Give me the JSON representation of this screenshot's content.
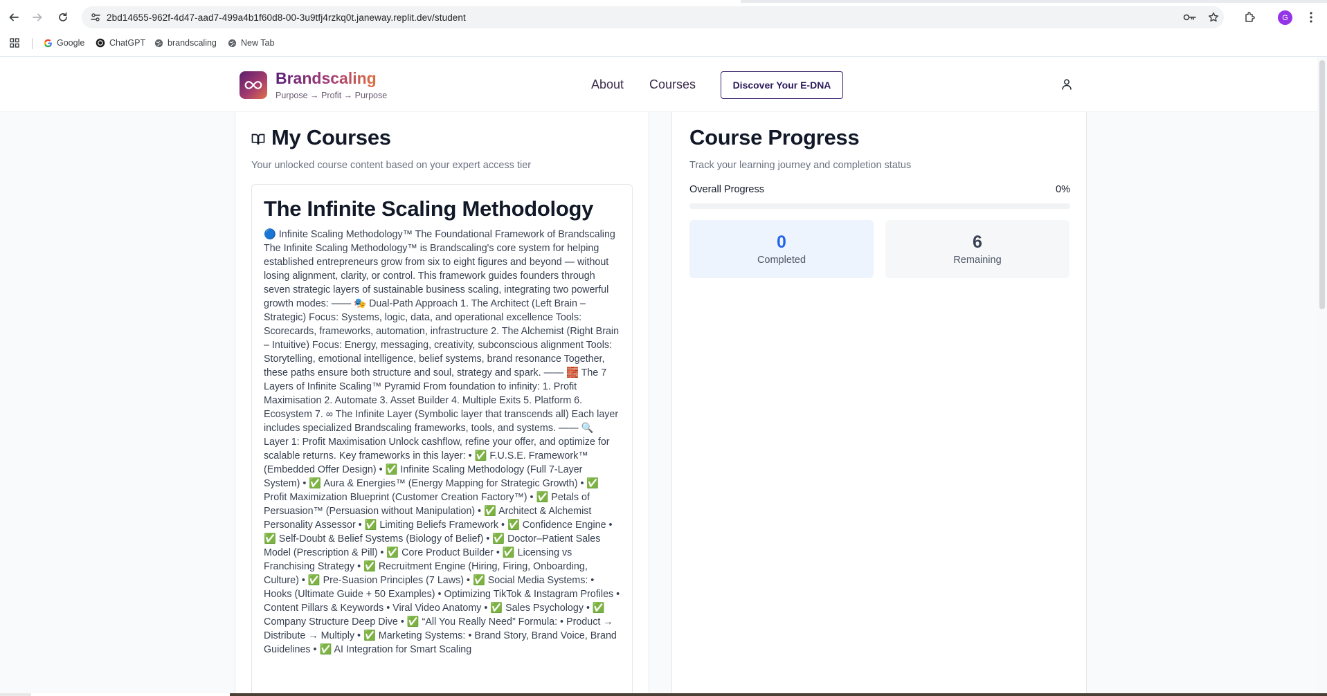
{
  "browser": {
    "url": "2bd14655-962f-4d47-aad7-499a4b1f60d8-00-3u9tfj4rzkq0t.janeway.replit.dev/student",
    "profile_initial": "G",
    "bookmarks": [
      {
        "label": "Google",
        "icon": "google-icon"
      },
      {
        "label": "ChatGPT",
        "icon": "chatgpt-icon"
      },
      {
        "label": "brandscaling",
        "icon": "globe-icon"
      },
      {
        "label": "New Tab",
        "icon": "globe-icon"
      }
    ]
  },
  "header": {
    "brand_name": "Brandscaling",
    "tagline": "Purpose → Profit → Purpose",
    "nav": {
      "about": "About",
      "courses": "Courses"
    },
    "cta_label": "Discover Your E-DNA"
  },
  "my_courses": {
    "title": "My Courses",
    "subtitle": "Your unlocked course content based on your expert access tier",
    "course": {
      "title": "The Infinite Scaling Methodology",
      "description": "🔵 Infinite Scaling Methodology™ The Foundational Framework of Brandscaling The Infinite Scaling Methodology™ is Brandscaling's core system for helping established entrepreneurs grow from six to eight figures and beyond — without losing alignment, clarity, or control. This framework guides founders through seven strategic layers of sustainable business scaling, integrating two powerful growth modes: —— 🎭 Dual-Path Approach 1. The Architect (Left Brain – Strategic) Focus: Systems, logic, data, and operational excellence Tools: Scorecards, frameworks, automation, infrastructure 2. The Alchemist (Right Brain – Intuitive) Focus: Energy, messaging, creativity, subconscious alignment Tools: Storytelling, emotional intelligence, belief systems, brand resonance Together, these paths ensure both structure and soul, strategy and spark. —— 🧱 The 7 Layers of Infinite Scaling™ Pyramid From foundation to infinity: 1. Profit Maximisation 2. Automate 3. Asset Builder 4. Multiple Exits 5. Platform 6. Ecosystem 7. ∞ The Infinite Layer (Symbolic layer that transcends all) Each layer includes specialized Brandscaling frameworks, tools, and systems. —— 🔍 Layer 1: Profit Maximisation Unlock cashflow, refine your offer, and optimize for scalable returns. Key frameworks in this layer: • ✅ F.U.S.E. Framework™ (Embedded Offer Design) • ✅ Infinite Scaling Methodology (Full 7-Layer System) • ✅ Aura & Energies™ (Energy Mapping for Strategic Growth) • ✅ Profit Maximization Blueprint (Customer Creation Factory™) • ✅ Petals of Persuasion™ (Persuasion without Manipulation) • ✅ Architect & Alchemist Personality Assessor • ✅ Limiting Beliefs Framework • ✅ Confidence Engine • ✅ Self-Doubt & Belief Systems (Biology of Belief) • ✅ Doctor–Patient Sales Model (Prescription & Pill) • ✅ Core Product Builder • ✅ Licensing vs Franchising Strategy • ✅ Recruitment Engine (Hiring, Firing, Onboarding, Culture) • ✅ Pre-Suasion Principles (7 Laws) • ✅ Social Media Systems: • Hooks (Ultimate Guide + 50 Examples) • Optimizing TikTok & Instagram Profiles • Content Pillars & Keywords • Viral Video Anatomy • ✅ Sales Psychology • ✅ Company Structure Deep Dive • ✅ “All You Really Need” Formula: • Product → Distribute → Multiply • ✅ Marketing Systems: • Brand Story, Brand Voice, Brand Guidelines • ✅ AI Integration for Smart Scaling"
    }
  },
  "progress": {
    "title": "Course Progress",
    "subtitle": "Track your learning journey and completion status",
    "overall_label": "Overall Progress",
    "overall_percent_text": "0%",
    "overall_fraction": 0,
    "completed_count": "0",
    "completed_label": "Completed",
    "remaining_count": "6",
    "remaining_label": "Remaining"
  },
  "colors": {
    "accent_blue": "#2563eb",
    "brand_purple": "#5b2079",
    "brand_orange": "#e0703f"
  }
}
